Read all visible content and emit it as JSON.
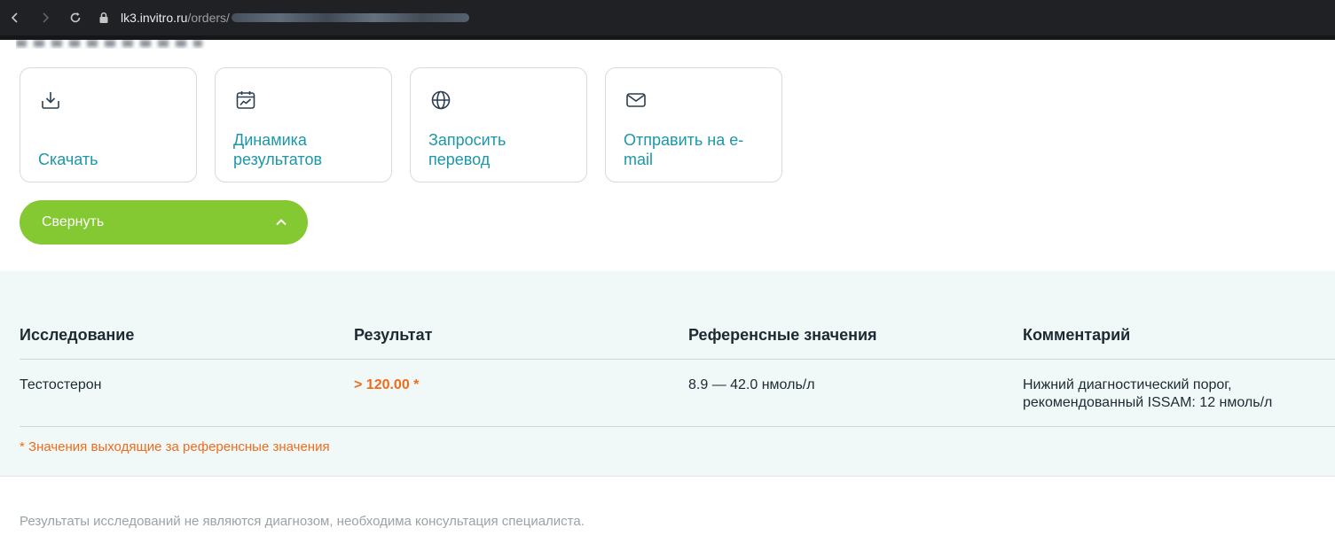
{
  "browser": {
    "url_host": "lk3.invitro.ru",
    "url_path": "/orders/"
  },
  "actions": [
    {
      "label": "Скачать",
      "icon": "download-icon"
    },
    {
      "label": "Динамика\nрезультатов",
      "icon": "calendar-chart-icon"
    },
    {
      "label": "Запросить\nперевод",
      "icon": "globe-icon"
    },
    {
      "label": "Отправить на e-\nmail",
      "icon": "envelope-icon"
    }
  ],
  "collapse_button": {
    "label": "Свернуть",
    "icon": "chevron-up-icon"
  },
  "colors": {
    "accent_green": "#84c832",
    "link_teal": "#1d97a8",
    "out_of_range_orange": "#ef6c1a",
    "results_bg": "#f1f8f8"
  },
  "table": {
    "headers": [
      "Исследование",
      "Результат",
      "Референсные значения",
      "Комментарий"
    ],
    "rows": [
      {
        "test": "Тестостерон",
        "result": "> 120.00 *",
        "reference": "8.9 — 42.0 нмоль/л",
        "comment": "Нижний диагностический порог,\nрекомендованный ISSAM: 12 нмоль/л"
      }
    ]
  },
  "footnote": "* Значения выходящие за референсные значения",
  "disclaimer": "Результаты исследований не являются диагнозом, необходима консультация специалиста."
}
